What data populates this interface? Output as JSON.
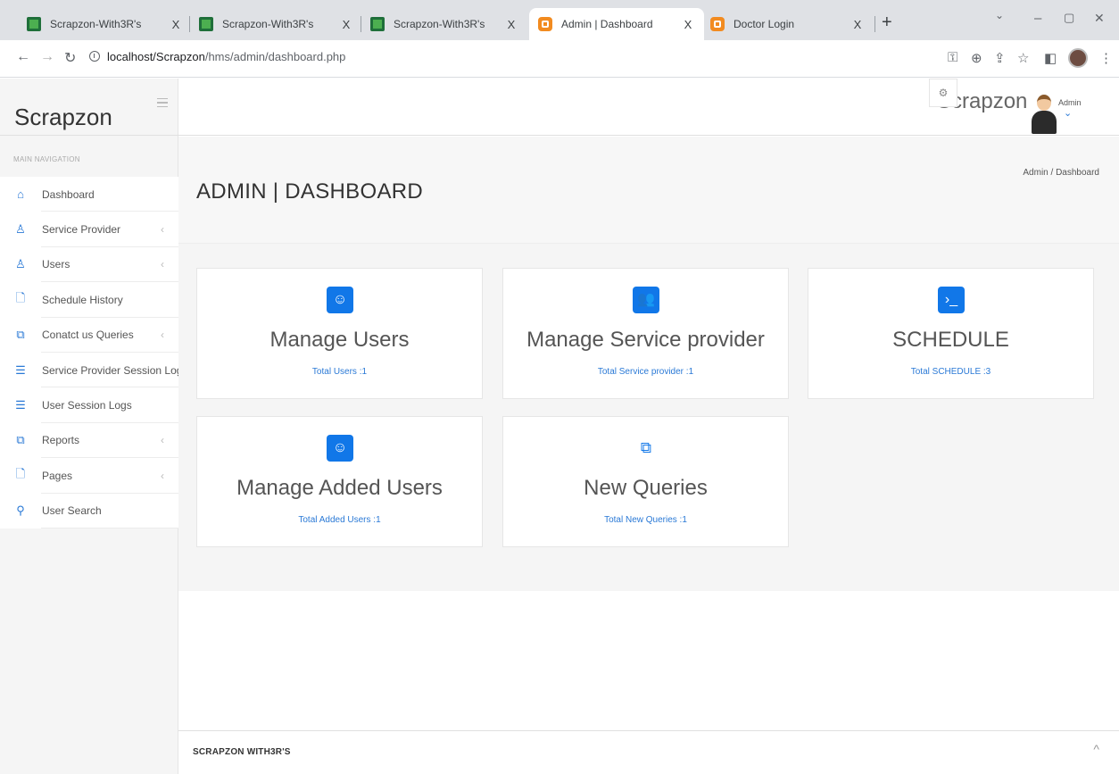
{
  "browser": {
    "tabs": [
      {
        "title": "Scrapzon-With3R's",
        "favicon": "green",
        "close": "X"
      },
      {
        "title": "Scrapzon-With3R's",
        "favicon": "green",
        "close": "X"
      },
      {
        "title": "Scrapzon-With3R's",
        "favicon": "green",
        "close": "X"
      },
      {
        "title": "Admin | Dashboard",
        "favicon": "orange",
        "close": "X"
      },
      {
        "title": "Doctor Login",
        "favicon": "orange",
        "close": "X"
      }
    ],
    "new_tab": "+",
    "url_host": "localhost/Scrapzon",
    "url_path": "/hms/admin/dashboard.php"
  },
  "sidebar": {
    "brand": "Scrapzon",
    "section_heading": "MAIN NAVIGATION",
    "items": [
      {
        "label": "Dashboard",
        "icon": "home-icon",
        "glyph": "⌂",
        "arrow": ""
      },
      {
        "label": "Service Provider",
        "icon": "user-icon",
        "glyph": "♙",
        "arrow": "‹"
      },
      {
        "label": "Users",
        "icon": "user-icon",
        "glyph": "♙",
        "arrow": "‹"
      },
      {
        "label": "Schedule History",
        "icon": "file-icon",
        "glyph": "🗋",
        "arrow": ""
      },
      {
        "label": "Conatct us Queries",
        "icon": "files-icon",
        "glyph": "⧉",
        "arrow": "‹"
      },
      {
        "label": "Service Provider Session Logs",
        "icon": "list-icon",
        "glyph": "☰",
        "arrow": ""
      },
      {
        "label": "User Session Logs",
        "icon": "list-icon",
        "glyph": "☰",
        "arrow": ""
      },
      {
        "label": "Reports",
        "icon": "files-icon",
        "glyph": "⧉",
        "arrow": "‹"
      },
      {
        "label": "Pages",
        "icon": "file-icon",
        "glyph": "🗋",
        "arrow": "‹"
      },
      {
        "label": "User Search",
        "icon": "search-icon",
        "glyph": "⚲",
        "arrow": ""
      }
    ]
  },
  "topbar": {
    "brand": "Scrapzon",
    "user": "Admin",
    "caret": "⌄"
  },
  "page": {
    "title": "ADMIN | DASHBOARD",
    "breadcrumb": "Admin  /  Dashboard"
  },
  "cards": [
    {
      "title": "Manage Users",
      "subtitle": "Total Users :1",
      "icon": "smile-icon",
      "glyph": "☺",
      "plain": false
    },
    {
      "title": "Manage Service provider",
      "subtitle": "Total Service provider :1",
      "icon": "users-icon",
      "glyph": "👥",
      "plain": false
    },
    {
      "title": "SCHEDULE",
      "subtitle": "Total SCHEDULE :3",
      "icon": "terminal-icon",
      "glyph": "›_",
      "plain": false
    },
    {
      "title": "Manage Added Users",
      "subtitle": "Total Added Users :1",
      "icon": "smile-icon",
      "glyph": "☺",
      "plain": false
    },
    {
      "title": "New Queries",
      "subtitle": "Total New Queries :1",
      "icon": "files-icon",
      "glyph": "⧉",
      "plain": true
    }
  ],
  "footer": {
    "text": "SCRAPZON WITH3R'S",
    "up": "^"
  }
}
